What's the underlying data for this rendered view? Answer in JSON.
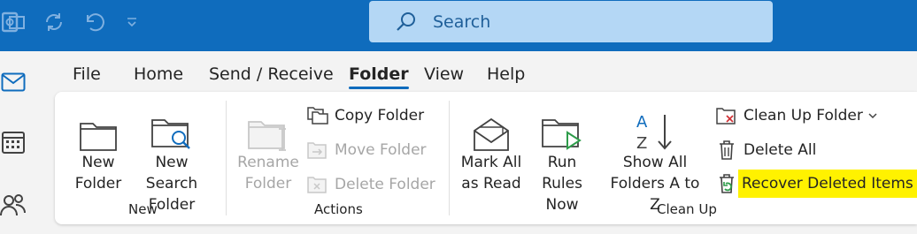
{
  "search": {
    "placeholder": "Search"
  },
  "tabs": [
    "File",
    "Home",
    "Send / Receive",
    "Folder",
    "View",
    "Help"
  ],
  "active_tab": "Folder",
  "groups": {
    "new": {
      "title": "New",
      "buttons": [
        {
          "label": "New\nFolder",
          "icon": "folder-icon"
        },
        {
          "label": "New Search\nFolder",
          "icon": "search-folder-icon"
        }
      ]
    },
    "actions": {
      "title": "Actions",
      "rename": {
        "label": "Rename\nFolder",
        "icon": "rename-folder-icon",
        "enabled": false
      },
      "copy": {
        "label": "Copy Folder",
        "icon": "copy-folder-icon",
        "enabled": true
      },
      "move": {
        "label": "Move Folder",
        "icon": "move-folder-icon",
        "enabled": false
      },
      "delete": {
        "label": "Delete Folder",
        "icon": "delete-folder-icon",
        "enabled": false
      }
    },
    "cleanup": {
      "title": "Clean Up",
      "mark_all": {
        "label": "Mark All\nas Read",
        "icon": "open-envelope-icon"
      },
      "run_rules": {
        "label": "Run Rules\nNow",
        "icon": "run-rules-icon"
      },
      "show_all": {
        "label": "Show All\nFolders A to Z",
        "icon": "sort-az-icon"
      },
      "clean_up_folder": {
        "label": "Clean Up Folder",
        "icon": "clean-up-folder-icon"
      },
      "delete_all": {
        "label": "Delete All",
        "icon": "delete-all-icon"
      },
      "recover": {
        "label": "Recover Deleted Items",
        "icon": "recover-deleted-icon",
        "highlighted": true
      }
    }
  },
  "colors": {
    "title_bar": "#0f6cbd",
    "search_box": "#b4d7f5",
    "highlight": "#fff200"
  }
}
